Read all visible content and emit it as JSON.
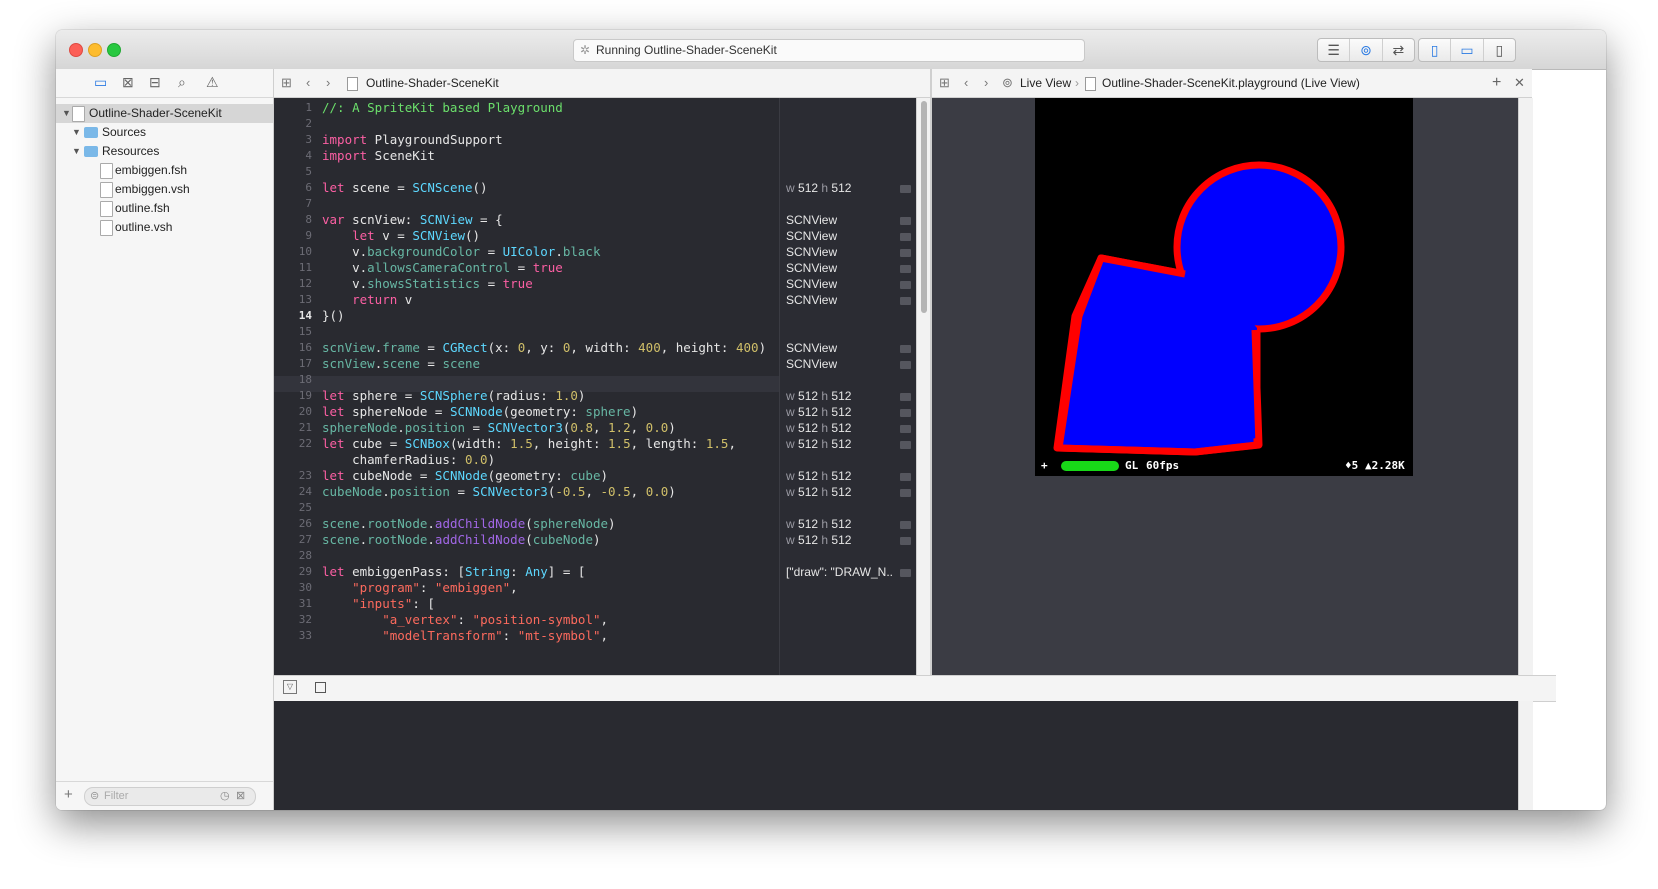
{
  "window": {
    "status_text": "Running Outline-Shader-SceneKit"
  },
  "navigator": {
    "project_name": "Outline-Shader-SceneKit",
    "items": [
      {
        "label": "Sources"
      },
      {
        "label": "Resources"
      },
      {
        "label": "embiggen.fsh"
      },
      {
        "label": "embiggen.vsh"
      },
      {
        "label": "outline.fsh"
      },
      {
        "label": "outline.vsh"
      }
    ],
    "filter_placeholder": "Filter"
  },
  "editor": {
    "jump_file": "Outline-Shader-SceneKit",
    "current_line": "14",
    "line_numbers": [
      "1",
      "2",
      "3",
      "4",
      "5",
      "6",
      "7",
      "8",
      "9",
      "10",
      "11",
      "12",
      "13",
      "14",
      "15",
      "16",
      "17",
      "18",
      "19",
      "20",
      "21",
      "22",
      "",
      "23",
      "24",
      "25",
      "26",
      "27",
      "28",
      "29",
      "30",
      "31",
      "32",
      "33"
    ]
  },
  "results": {
    "lines": [
      {
        "row": 6,
        "w": "w",
        "a": "512",
        "h": "h",
        "b": "512"
      },
      {
        "row": 8,
        "text": "SCNView"
      },
      {
        "row": 9,
        "text": "SCNView"
      },
      {
        "row": 10,
        "text": "SCNView"
      },
      {
        "row": 11,
        "text": "SCNView"
      },
      {
        "row": 12,
        "text": "SCNView"
      },
      {
        "row": 13,
        "text": "SCNView"
      },
      {
        "row": 16,
        "text": "SCNView"
      },
      {
        "row": 17,
        "text": "SCNView"
      },
      {
        "row": 19,
        "w": "w",
        "a": "512",
        "h": "h",
        "b": "512"
      },
      {
        "row": 20,
        "w": "w",
        "a": "512",
        "h": "h",
        "b": "512"
      },
      {
        "row": 21,
        "w": "w",
        "a": "512",
        "h": "h",
        "b": "512"
      },
      {
        "row": 22,
        "w": "w",
        "a": "512",
        "h": "h",
        "b": "512"
      },
      {
        "row": 24,
        "w": "w",
        "a": "512",
        "h": "h",
        "b": "512"
      },
      {
        "row": 25,
        "w": "w",
        "a": "512",
        "h": "h",
        "b": "512"
      },
      {
        "row": 27,
        "w": "w",
        "a": "512",
        "h": "h",
        "b": "512"
      },
      {
        "row": 28,
        "w": "w",
        "a": "512",
        "h": "h",
        "b": "512"
      },
      {
        "row": 30,
        "text": "[\"draw\": \"DRAW_N..."
      }
    ]
  },
  "liveview": {
    "jump_live": "Live View",
    "jump_file": "Outline-Shader-SceneKit.playground (Live View)",
    "stats_plus": "+",
    "stats_gl": "GL",
    "stats_fps": "60fps",
    "stats_nodes": "♦5",
    "stats_tris": "▲2.28K",
    "colors": {
      "shape_fill": "#0000ff",
      "outline": "#ff0000",
      "background": "#000000"
    }
  }
}
